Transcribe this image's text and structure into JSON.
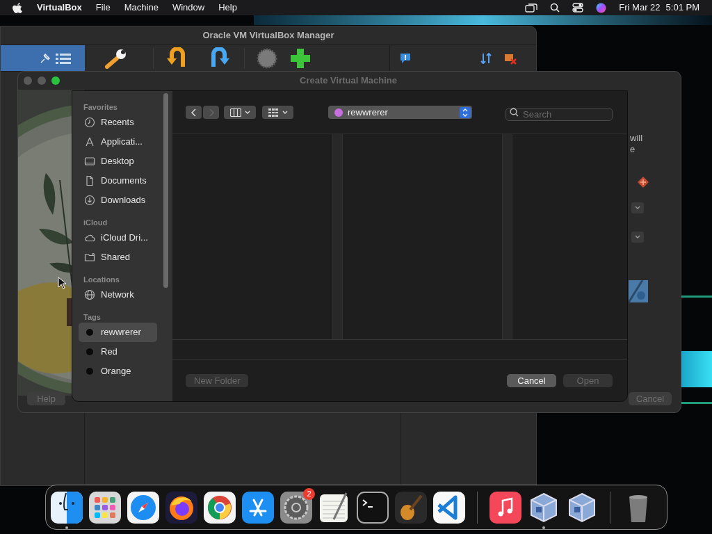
{
  "menu_bar": {
    "app": "VirtualBox",
    "menus": [
      "File",
      "Machine",
      "Window",
      "Help"
    ],
    "date": "Fri Mar 22",
    "time": "5:01 PM"
  },
  "manager_window": {
    "title": "Oracle VM VirtualBox Manager"
  },
  "create_vm_window": {
    "title": "Create Virtual Machine",
    "text_fragments": [
      "will",
      "e"
    ],
    "help_button": {
      "label": "Help",
      "disabled": true
    },
    "cancel_button": {
      "label": "Cancel",
      "disabled": true
    }
  },
  "open_dialog": {
    "sidebar": [
      {
        "title": "Favorites",
        "items": [
          {
            "label": "Recents",
            "kind": "clock",
            "selected": false
          },
          {
            "label": "Applicati...",
            "kind": "apps",
            "selected": false
          },
          {
            "label": "Desktop",
            "kind": "desktop",
            "selected": false
          },
          {
            "label": "Documents",
            "kind": "document",
            "selected": false
          },
          {
            "label": "Downloads",
            "kind": "download",
            "selected": false
          }
        ]
      },
      {
        "title": "iCloud",
        "items": [
          {
            "label": "iCloud Dri...",
            "kind": "cloud",
            "selected": false
          },
          {
            "label": "Shared",
            "kind": "folder",
            "selected": false
          }
        ]
      },
      {
        "title": "Locations",
        "items": [
          {
            "label": "Network",
            "kind": "globe",
            "selected": false
          }
        ]
      },
      {
        "title": "Tags",
        "items": [
          {
            "label": "rewwrerer",
            "kind": "tag",
            "color": "#0a0a0a",
            "selected": true
          },
          {
            "label": "Red",
            "kind": "tag",
            "color": "#0a0a0a",
            "selected": false
          },
          {
            "label": "Orange",
            "kind": "tag",
            "color": "#0a0a0a",
            "selected": false
          }
        ]
      }
    ],
    "back_disabled": false,
    "forward_disabled": true,
    "location": {
      "label": "rewwrerer",
      "color": "#c86ee0"
    },
    "search": {
      "placeholder": "Search"
    },
    "new_folder": {
      "label": "New Folder",
      "disabled": true
    },
    "cancel": {
      "label": "Cancel",
      "disabled": false
    },
    "open": {
      "label": "Open",
      "disabled": true
    }
  },
  "dock": {
    "apps": [
      {
        "kind": "finder",
        "running": true
      },
      {
        "kind": "launchpad",
        "running": false
      },
      {
        "kind": "safari",
        "running": false
      },
      {
        "kind": "firefox",
        "running": false
      },
      {
        "kind": "chrome",
        "running": false
      },
      {
        "kind": "appstore",
        "running": false
      },
      {
        "kind": "settings",
        "running": false,
        "badge": "2"
      },
      {
        "kind": "textedit",
        "running": false
      },
      {
        "kind": "terminal",
        "running": false
      },
      {
        "kind": "garageband",
        "running": false
      },
      {
        "kind": "vscode",
        "running": false
      },
      {
        "kind": "separator"
      },
      {
        "kind": "music",
        "running": false
      },
      {
        "kind": "virtualbox",
        "running": true
      },
      {
        "kind": "virtualbox",
        "running": false
      },
      {
        "kind": "separator"
      },
      {
        "kind": "trash",
        "running": false
      }
    ]
  }
}
